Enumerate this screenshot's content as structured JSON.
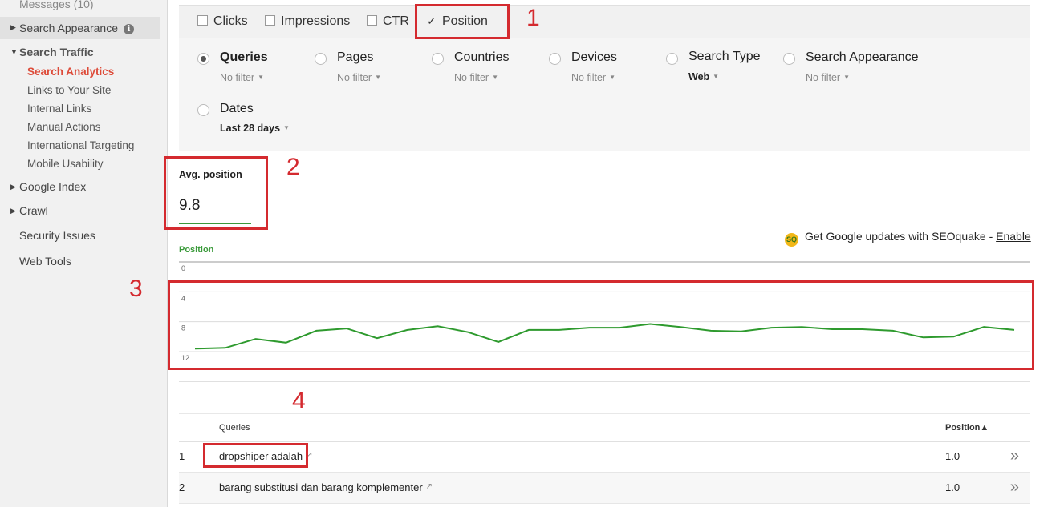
{
  "sidebar": {
    "messages": "Messages (10)",
    "search_appearance": "Search Appearance",
    "search_traffic": "Search Traffic",
    "sub_items": [
      {
        "label": "Search Analytics"
      },
      {
        "label": "Links to Your Site"
      },
      {
        "label": "Internal Links"
      },
      {
        "label": "Manual Actions"
      },
      {
        "label": "International Targeting"
      },
      {
        "label": "Mobile Usability"
      }
    ],
    "google_index": "Google Index",
    "crawl": "Crawl",
    "security_issues": "Security Issues",
    "web_tools": "Web Tools",
    "info_icon_glyph": "i"
  },
  "metrics": {
    "clicks": "Clicks",
    "impressions": "Impressions",
    "ctr": "CTR",
    "position": "Position",
    "position_checked": true
  },
  "dimensions": [
    {
      "title": "Queries",
      "filter": "No filter",
      "selected": true
    },
    {
      "title": "Pages",
      "filter": "No filter",
      "selected": false
    },
    {
      "title": "Countries",
      "filter": "No filter",
      "selected": false
    },
    {
      "title": "Devices",
      "filter": "No filter",
      "selected": false
    },
    {
      "title": "Search Type",
      "filter": "Web",
      "selected": false
    },
    {
      "title": "Search Appearance",
      "filter": "No filter",
      "selected": false
    },
    {
      "title": "Dates",
      "filter": "Last 28 days",
      "selected": false
    }
  ],
  "avg_position": {
    "label": "Avg. position",
    "value": "9.8"
  },
  "seoquake": {
    "icon_text": "SQ",
    "text": "Get Google updates with SEOquake - ",
    "link": "Enable"
  },
  "chart_data": {
    "type": "line",
    "legend": "Position",
    "ylim": [
      0,
      12
    ],
    "y_inverted": true,
    "ytick_labels": [
      "0",
      "4",
      "8",
      "12"
    ],
    "series": [
      {
        "name": "Position",
        "values": [
          11.6,
          11.5,
          10.3,
          10.8,
          9.2,
          8.9,
          10.2,
          9.1,
          8.6,
          9.4,
          10.7,
          9.1,
          9.1,
          8.8,
          8.8,
          8.3,
          8.7,
          9.2,
          9.3,
          8.8,
          8.7,
          9.0,
          9.0,
          9.2,
          10.1,
          10.0,
          8.7,
          9.1
        ]
      }
    ],
    "line_color": "#2e9a2e"
  },
  "table": {
    "headers": {
      "queries": "Queries",
      "position": "Position▲"
    },
    "rows": [
      {
        "index": "1",
        "query": "dropshiper adalah",
        "position": "1.0"
      },
      {
        "index": "2",
        "query": "barang substitusi dan barang komplementer",
        "position": "1.0"
      }
    ]
  },
  "annotations": {
    "n1": "1",
    "n2": "2",
    "n3": "3",
    "n4": "4"
  },
  "colors": {
    "annotation_red": "#d42a2f",
    "accent_green": "#3a9a3a",
    "active_nav_red": "#dd4b39"
  }
}
